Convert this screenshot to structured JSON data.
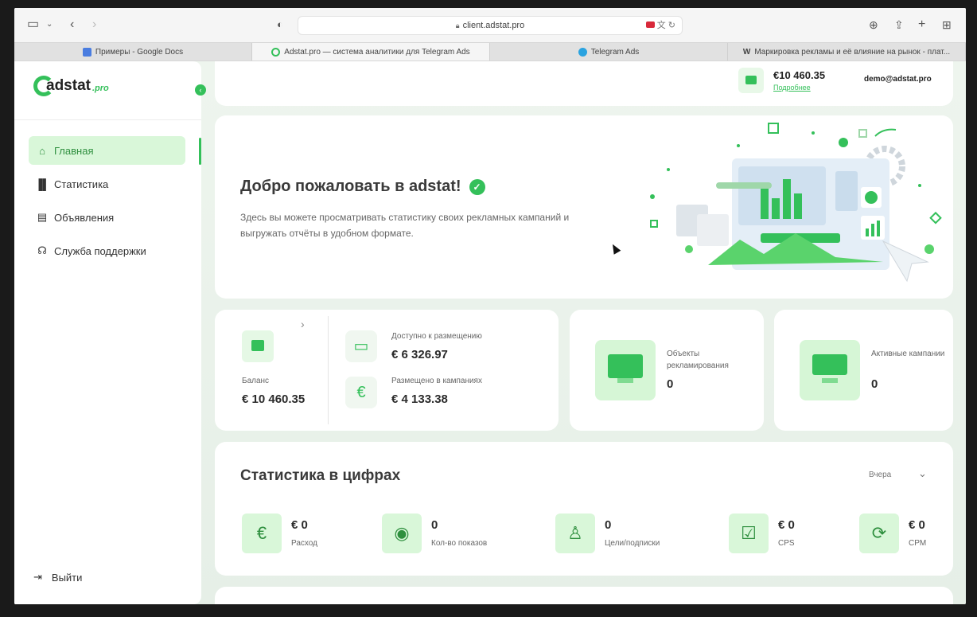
{
  "browser": {
    "url": "client.adstat.pro",
    "tabs": [
      {
        "label": "Примеры - Google Docs",
        "favicon_color": "#4a7de0"
      },
      {
        "label": "Adstat.pro — система аналитики для Telegram Ads",
        "favicon_color": "#34c05a"
      },
      {
        "label": "Telegram Ads",
        "favicon_color": "#2aa3e0"
      },
      {
        "label": "Маркировка рекламы и её влияние на рынок - плат...",
        "favicon_color": "#222222"
      }
    ]
  },
  "brand": {
    "name": "adstat",
    "suffix": ".pro",
    "accent": "#34c05a"
  },
  "sidebar": {
    "items": [
      {
        "label": "Главная",
        "icon": "home-icon"
      },
      {
        "label": "Статистика",
        "icon": "bar-chart-icon"
      },
      {
        "label": "Объявления",
        "icon": "document-icon"
      },
      {
        "label": "Служба поддержки",
        "icon": "headset-icon"
      }
    ],
    "logout": "Выйти"
  },
  "topbar": {
    "balance": "€10 460.35",
    "details_link": "Подробнее",
    "user": "demo@adstat.pro"
  },
  "welcome": {
    "title": "Добро пожаловать в adstat!",
    "text": "Здесь вы можете просматривать статистику своих рекламных кампаний и выгружать отчёты в удобном формате."
  },
  "finance": {
    "balance_label": "Баланс",
    "balance_value": "€ 10 460.35",
    "available_label": "Доступно к размещению",
    "available_value": "€ 6 326.97",
    "placed_label": "Размещено в кампаниях",
    "placed_value": "€ 4 133.38"
  },
  "kpis": [
    {
      "label": "Объекты рекламирования",
      "value": "0"
    },
    {
      "label": "Активные кампании",
      "value": "0"
    }
  ],
  "stats": {
    "title": "Статистика в цифрах",
    "period": "Вчера",
    "metrics": [
      {
        "value": "€ 0",
        "label": "Расход",
        "icon": "euro-icon"
      },
      {
        "value": "0",
        "label": "Кол-во показов",
        "icon": "eye-icon"
      },
      {
        "value": "0",
        "label": "Цели/подписки",
        "icon": "user-icon"
      },
      {
        "value": "€ 0",
        "label": "CPS",
        "icon": "checkbox-icon"
      },
      {
        "value": "€ 0",
        "label": "CPM",
        "icon": "euro-refresh-icon"
      }
    ]
  }
}
